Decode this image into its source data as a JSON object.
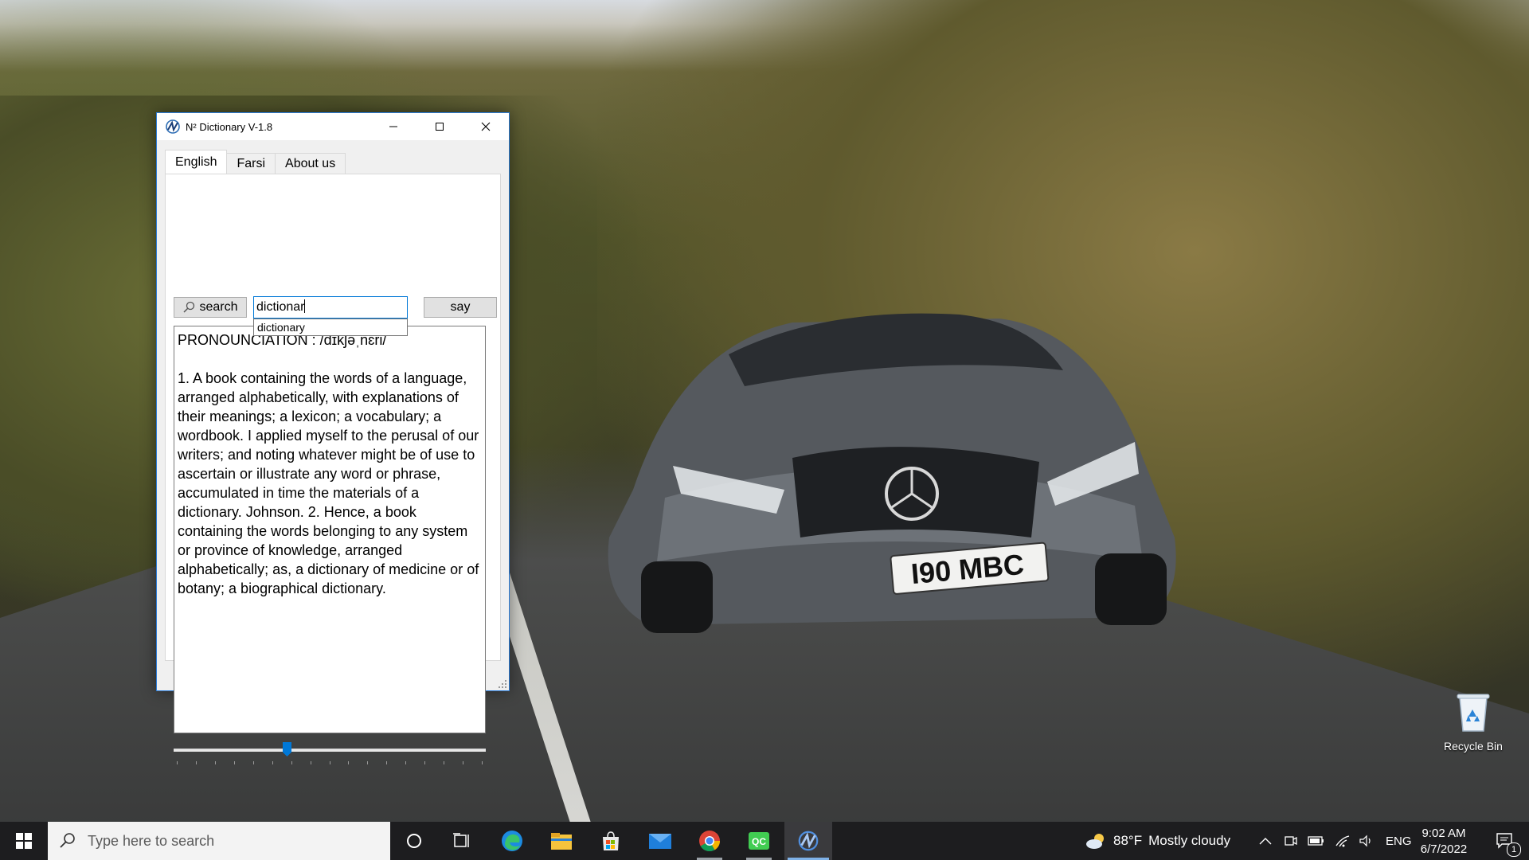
{
  "window": {
    "title": "N² Dictionary V-1.8",
    "tabs": [
      {
        "label": "English",
        "active": true
      },
      {
        "label": "Farsi",
        "active": false
      },
      {
        "label": "About us",
        "active": false
      }
    ],
    "search_button": "search",
    "say_button": "say",
    "search_value": "dictionar",
    "suggestion": "dictionary",
    "pronunciation": "PRONOUNCIATION : /dɪkʃəˌnɛri/",
    "definition": "1. A book containing the words of a language, arranged alphabetically, with explanations of their meanings; a lexicon; a vocabulary; a wordbook. I applied myself to the perusal of our writers; and noting whatever might be of use to ascertain or illustrate any word or phrase, accumulated in time the materials of a dictionary. Johnson. 2. Hence, a book containing the words belonging to any system or province of knowledge, arranged alphabetically; as, a dictionary of medicine or of botany; a biographical dictionary.",
    "slider": {
      "value": 0.36,
      "tick_count": 17
    }
  },
  "desktop": {
    "recycle_bin_label": "Recycle Bin",
    "license_plate": "I90 MBC"
  },
  "taskbar": {
    "search_placeholder": "Type here to search",
    "pinned_icons": [
      "task-view-icon",
      "edge-icon",
      "file-explorer-icon",
      "microsoft-store-icon",
      "mail-icon",
      "chrome-icon",
      "qc-app-icon",
      "n2-dictionary-icon"
    ],
    "weather_temp": "88°F",
    "weather_text": "Mostly cloudy",
    "language": "ENG",
    "time": "9:02 AM",
    "date": "6/7/2022",
    "notification_count": "1"
  },
  "colors": {
    "accent": "#0078d7",
    "taskbar": "#1d1d1f"
  }
}
